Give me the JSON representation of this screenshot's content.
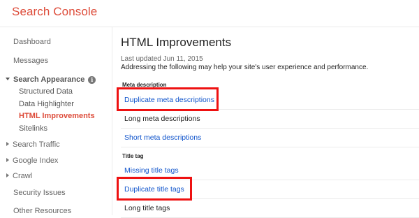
{
  "app": {
    "title": "Search Console"
  },
  "sidebar": {
    "items": [
      {
        "label": "Dashboard"
      },
      {
        "label": "Messages"
      },
      {
        "label": "Search Appearance"
      },
      {
        "label": "Structured Data"
      },
      {
        "label": "Data Highlighter"
      },
      {
        "label": "HTML Improvements"
      },
      {
        "label": "Sitelinks"
      },
      {
        "label": "Search Traffic"
      },
      {
        "label": "Google Index"
      },
      {
        "label": "Crawl"
      },
      {
        "label": "Security Issues"
      },
      {
        "label": "Other Resources"
      }
    ],
    "info_glyph": "i"
  },
  "main": {
    "title": "HTML Improvements",
    "last_updated": "Last updated Jun 11, 2015",
    "intro": "Addressing the following may help your site's user experience and performance.",
    "groups": [
      {
        "label": "Meta description",
        "rows": [
          {
            "text": "Duplicate meta descriptions",
            "link": true,
            "highlighted": true
          },
          {
            "text": "Long meta descriptions",
            "link": false,
            "highlighted": false
          },
          {
            "text": "Short meta descriptions",
            "link": true,
            "highlighted": false
          }
        ]
      },
      {
        "label": "Title tag",
        "rows": [
          {
            "text": "Missing title tags",
            "link": true,
            "highlighted": false
          },
          {
            "text": "Duplicate title tags",
            "link": true,
            "highlighted": true
          },
          {
            "text": "Long title tags",
            "link": false,
            "highlighted": false
          }
        ]
      }
    ]
  },
  "colors": {
    "brand": "#dd4b39",
    "link": "#1155cc",
    "highlight": "#ee1111"
  }
}
